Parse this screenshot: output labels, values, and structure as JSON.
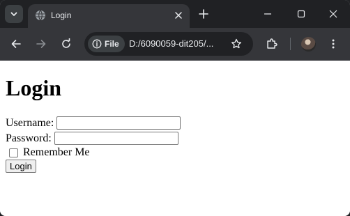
{
  "browser": {
    "tab": {
      "title": "Login",
      "favicon": "globe-icon",
      "close_icon": "close-icon"
    },
    "toolbar": {
      "site_info_label": "File",
      "url": "D:/6090059-dit205/...",
      "icons": [
        "back-arrow-icon",
        "forward-arrow-icon",
        "reload-icon",
        "star-icon",
        "extensions-icon",
        "avatar",
        "kebab-menu-icon"
      ]
    },
    "window_controls": [
      "minimize-icon",
      "maximize-icon",
      "close-icon"
    ],
    "colors": {
      "tabstrip": "#202124",
      "toolbar": "#35363a",
      "omnibox": "#202124",
      "text": "#e8eaed"
    }
  },
  "page": {
    "heading": "Login",
    "username_label": "Username:",
    "username_value": "",
    "password_label": "Password:",
    "password_value": "",
    "remember_label": "Remember Me",
    "remember_checked": false,
    "submit_label": "Login"
  }
}
